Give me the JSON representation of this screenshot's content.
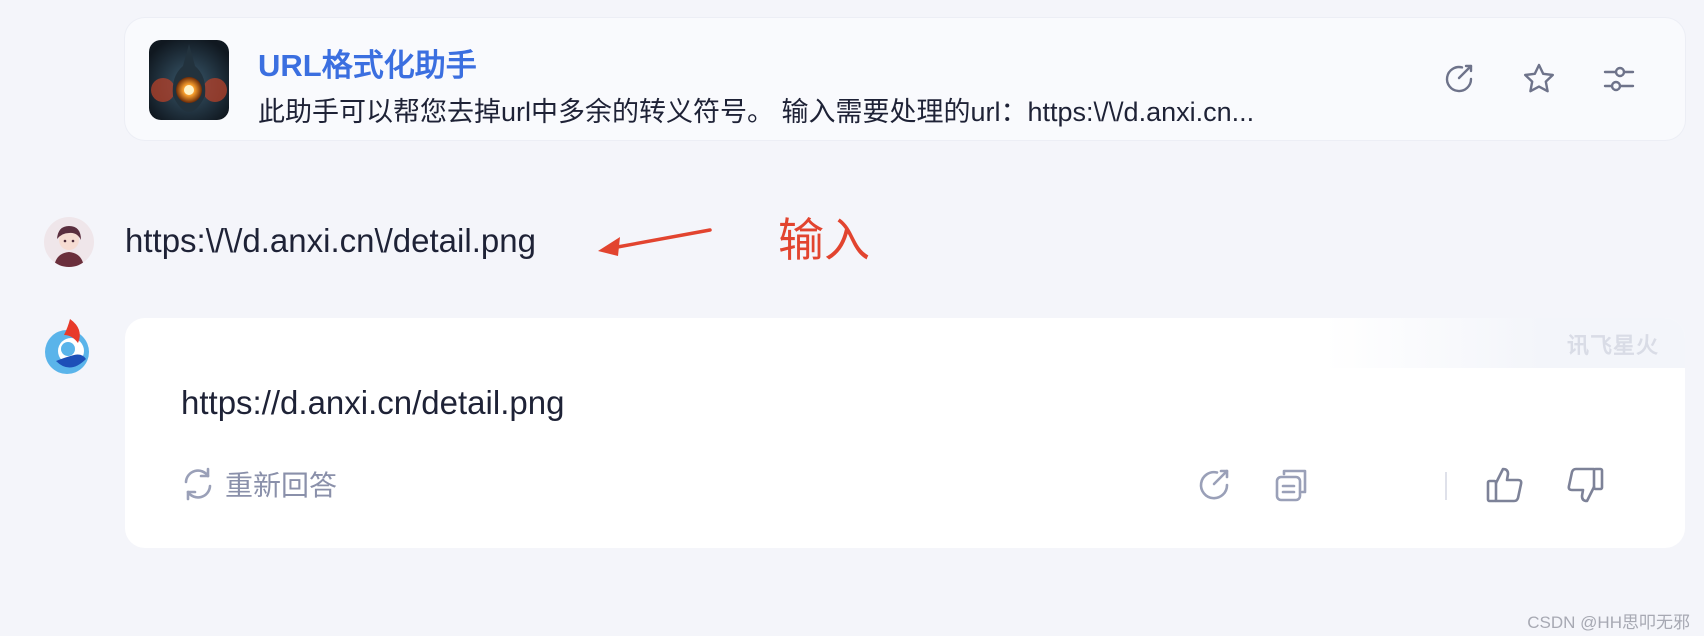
{
  "assistant": {
    "title": "URL格式化助手",
    "description": "此助手可以帮您去掉url中多余的转义符号。 输入需要处理的url：https:\\/\\/d.anxi.cn..."
  },
  "header_icons": [
    "share-icon",
    "star-icon",
    "settings-sliders-icon"
  ],
  "conversation": {
    "user_message": "https:\\/\\/d.anxi.cn\\/detail.png",
    "annotation": "输入",
    "bot_answer": "https://d.anxi.cn/detail.png",
    "watermark": "讯飞星火",
    "regenerate_label": "重新回答"
  },
  "answer_actions": [
    "share-icon",
    "copy-icon",
    "thumbs-up-icon",
    "thumbs-down-icon"
  ],
  "footer": {
    "credit": "CSDN @HH思叩无邪"
  },
  "colors": {
    "accent": "#3b6fe0",
    "annotation": "#e2442f",
    "icon": "#6e738a",
    "muted_icon": "#9aa0b8"
  }
}
